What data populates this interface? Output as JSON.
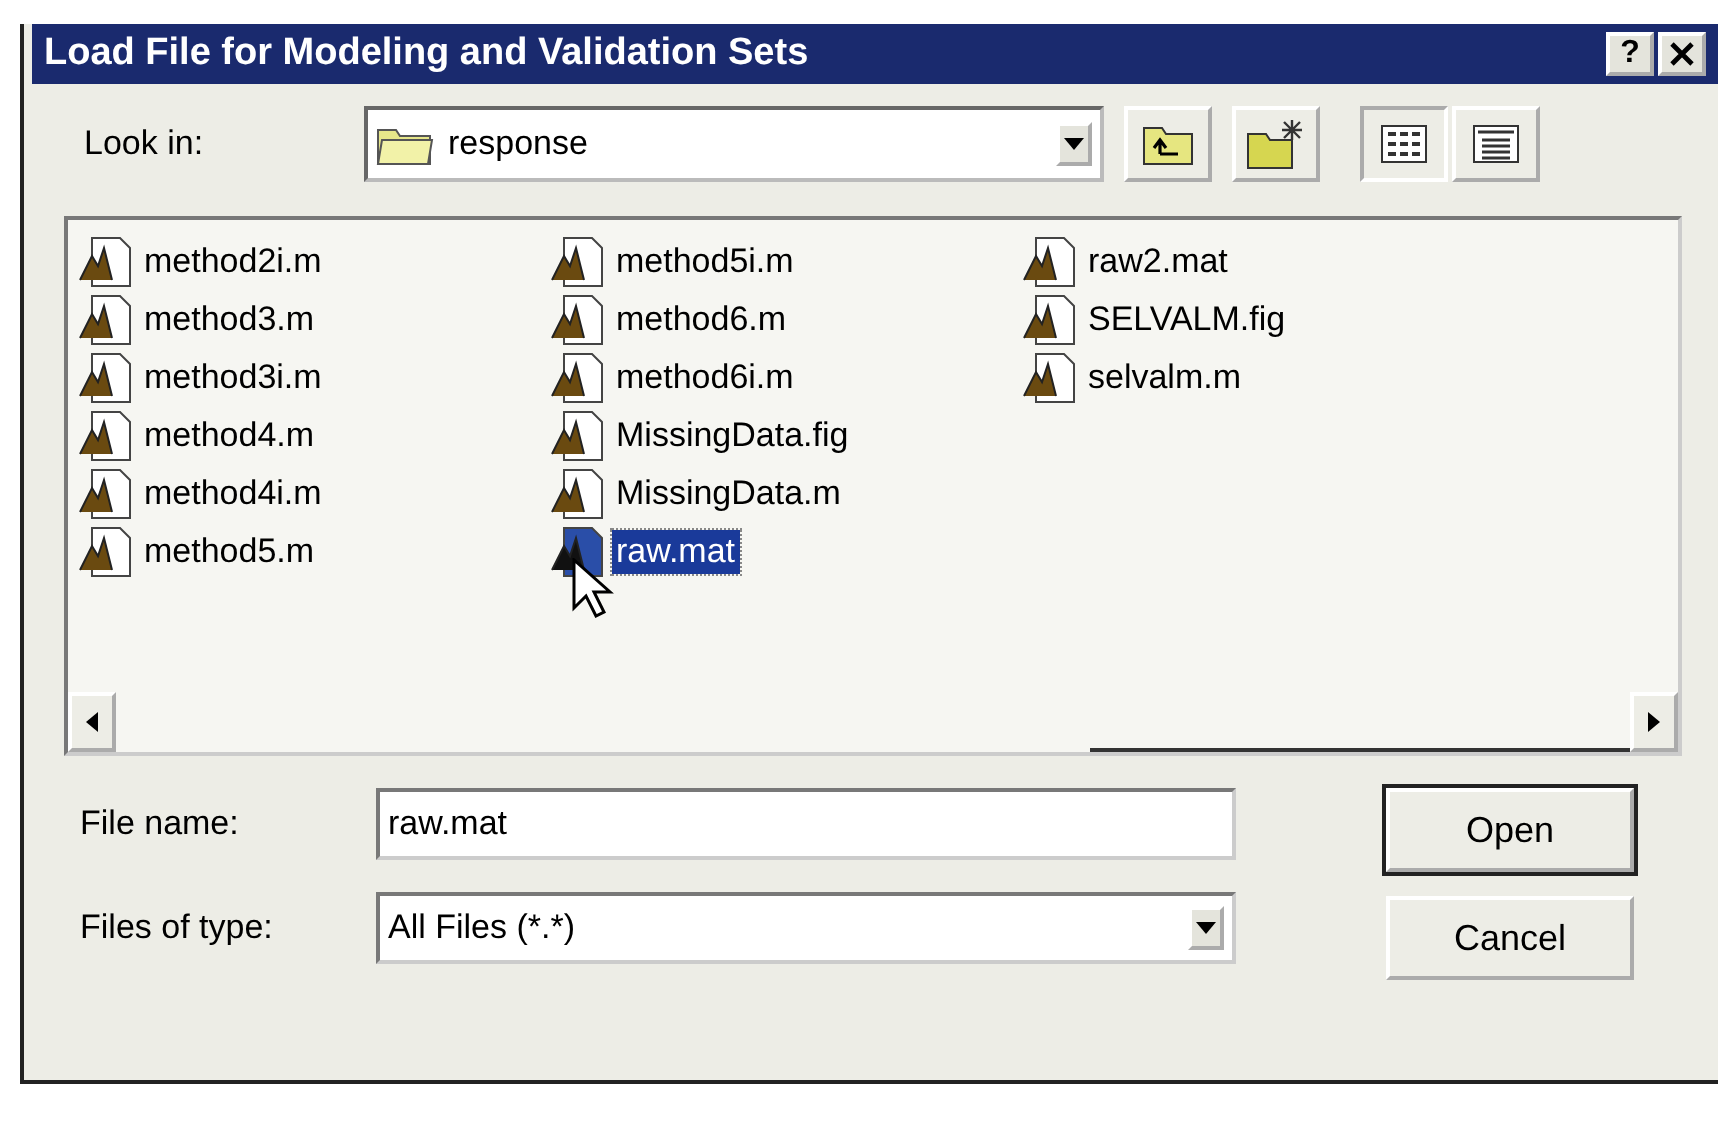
{
  "window": {
    "title": "Load File for Modeling and Validation Sets",
    "buttons": [
      "?"
    ]
  },
  "look_in": {
    "label": "Look in:",
    "value": "response"
  },
  "files": [
    {
      "name": "method2i.m",
      "selected": false
    },
    {
      "name": "method3.m",
      "selected": false
    },
    {
      "name": "method3i.m",
      "selected": false
    },
    {
      "name": "method4.m",
      "selected": false
    },
    {
      "name": "method4i.m",
      "selected": false
    },
    {
      "name": "method5.m",
      "selected": false
    },
    {
      "name": "method5i.m",
      "selected": false
    },
    {
      "name": "method6.m",
      "selected": false
    },
    {
      "name": "method6i.m",
      "selected": false
    },
    {
      "name": "MissingData.fig",
      "selected": false
    },
    {
      "name": "MissingData.m",
      "selected": false
    },
    {
      "name": "raw.mat",
      "selected": true
    },
    {
      "name": "raw2.mat",
      "selected": false
    },
    {
      "name": "SELVALM.fig",
      "selected": false
    },
    {
      "name": "selvalm.m",
      "selected": false
    }
  ],
  "file_name": {
    "label": "File name:",
    "value": "raw.mat"
  },
  "file_type": {
    "label": "Files of type:",
    "value": "All Files (*.*)"
  },
  "actions": [
    "Open",
    "Cancel"
  ]
}
